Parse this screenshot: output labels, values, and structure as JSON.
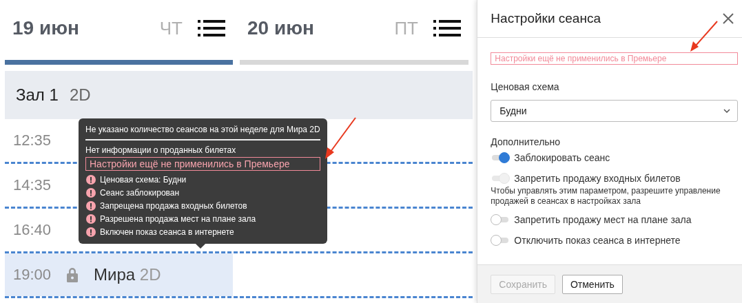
{
  "days": [
    {
      "date": "19 июн",
      "weekday": "ЧТ",
      "selected": true
    },
    {
      "date": "20 июн",
      "weekday": "ПТ",
      "selected": false
    }
  ],
  "hall": {
    "name": "Зал 1",
    "format": "2D"
  },
  "sessions": [
    {
      "time": "12:35",
      "selected": false
    },
    {
      "time": "14:35",
      "selected": false
    },
    {
      "time": "16:40",
      "selected": false
    },
    {
      "time": "19:00",
      "title": "Мира",
      "format": "2D",
      "locked": true,
      "selected": true
    }
  ],
  "tooltip": {
    "header": "Не указано количество сеансов на этой неделе для Мира 2D",
    "info": "Нет информации о проданных билетах",
    "warning": "Настройки ещё не применились в Премьере",
    "items": [
      "Ценовая схема: Будни",
      "Сеанс заблокирован",
      "Запрещена продажа входных билетов",
      "Разрешена продажа мест на плане зала",
      "Включен показ сеанса в интернете"
    ]
  },
  "panel": {
    "title": "Настройки сеанса",
    "warning": "Настройки ещё не применились в Премьере",
    "price_label": "Ценовая схема",
    "price_value": "Будни",
    "extra_label": "Дополнительно",
    "toggles": [
      {
        "label": "Заблокировать сеанс",
        "on": true,
        "disabled": false
      },
      {
        "label": "Запретить продажу входных билетов",
        "on": true,
        "disabled": true,
        "hint": "Чтобы управлять этим параметром, разрешите управление продажей в сеансах в настройках зала"
      },
      {
        "label": "Запретить продажу мест на плане зала",
        "on": false,
        "disabled": false
      },
      {
        "label": "Отключить показ сеанса в интернете",
        "on": false,
        "disabled": false
      }
    ],
    "buttons": [
      {
        "label": "Сохранить",
        "disabled": true
      },
      {
        "label": "Отменить",
        "disabled": false
      }
    ]
  }
}
